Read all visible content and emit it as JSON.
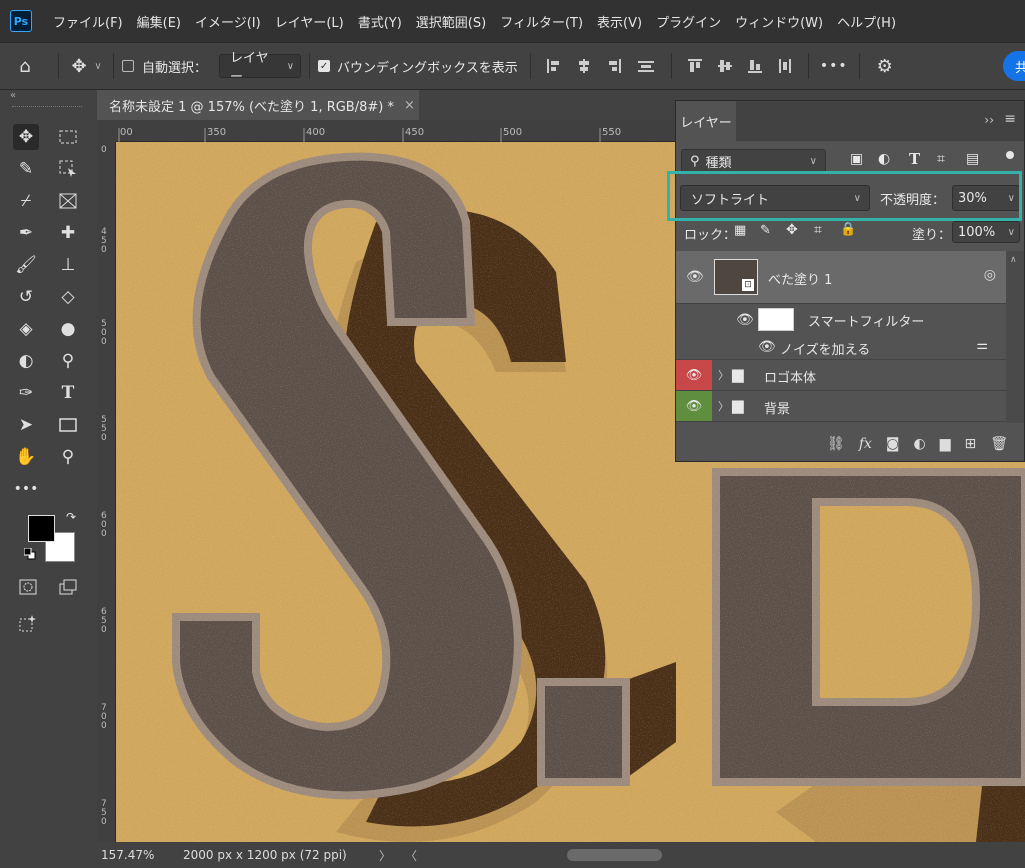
{
  "app": {
    "logo": "Ps"
  },
  "menu": [
    "ファイル(F)",
    "編集(E)",
    "イメージ(I)",
    "レイヤー(L)",
    "書式(Y)",
    "選択範囲(S)",
    "フィルター(T)",
    "表示(V)",
    "プラグイン",
    "ウィンドウ(W)",
    "ヘルプ(H)"
  ],
  "options": {
    "auto_select_label": "自動選択：",
    "auto_select_checked": false,
    "auto_select_target": "レイヤー",
    "bbox_label": "バウンディングボックスを表示",
    "bbox_checked": true,
    "more_label": "•••",
    "share_label": "共"
  },
  "document": {
    "tab_title": "名称未設定 1 @ 157% (べた塗り 1, RGB/8#) *",
    "close_glyph": "×",
    "ruler_top": [
      "00",
      "350",
      "400",
      "450",
      "500",
      "550"
    ],
    "ruler_left": [
      "0",
      "4 5 0",
      "5 0 0",
      "5 5 0",
      "6 0 0",
      "6 5 0",
      "7 0 0",
      "7 5 0"
    ],
    "canvas_text": "S.D",
    "zoom": "157.47%",
    "doc_size": "2000 px x 1200 px (72 ppi)"
  },
  "layers_panel": {
    "title": "レイヤー",
    "filter_kind": "種類",
    "blend_mode": "ソフトライト",
    "opacity_label": "不透明度：",
    "opacity_value": "30%",
    "lock_label": "ロック：",
    "fill_label": "塗り：",
    "fill_value": "100%",
    "layers": [
      {
        "name": "べた塗り 1",
        "type": "fill"
      },
      {
        "name": "スマートフィルター",
        "type": "smart-filter"
      },
      {
        "name": "ノイズを加える",
        "type": "filter"
      },
      {
        "name": "ロゴ本体",
        "type": "group",
        "eye_color": "#c8484a"
      },
      {
        "name": "背景",
        "type": "group",
        "eye_color": "#5f8f3e"
      }
    ]
  },
  "colors": {
    "highlight": "#33b2a8",
    "canvas_bg": "#cfa65c",
    "letter_face": "#5b4f47"
  }
}
